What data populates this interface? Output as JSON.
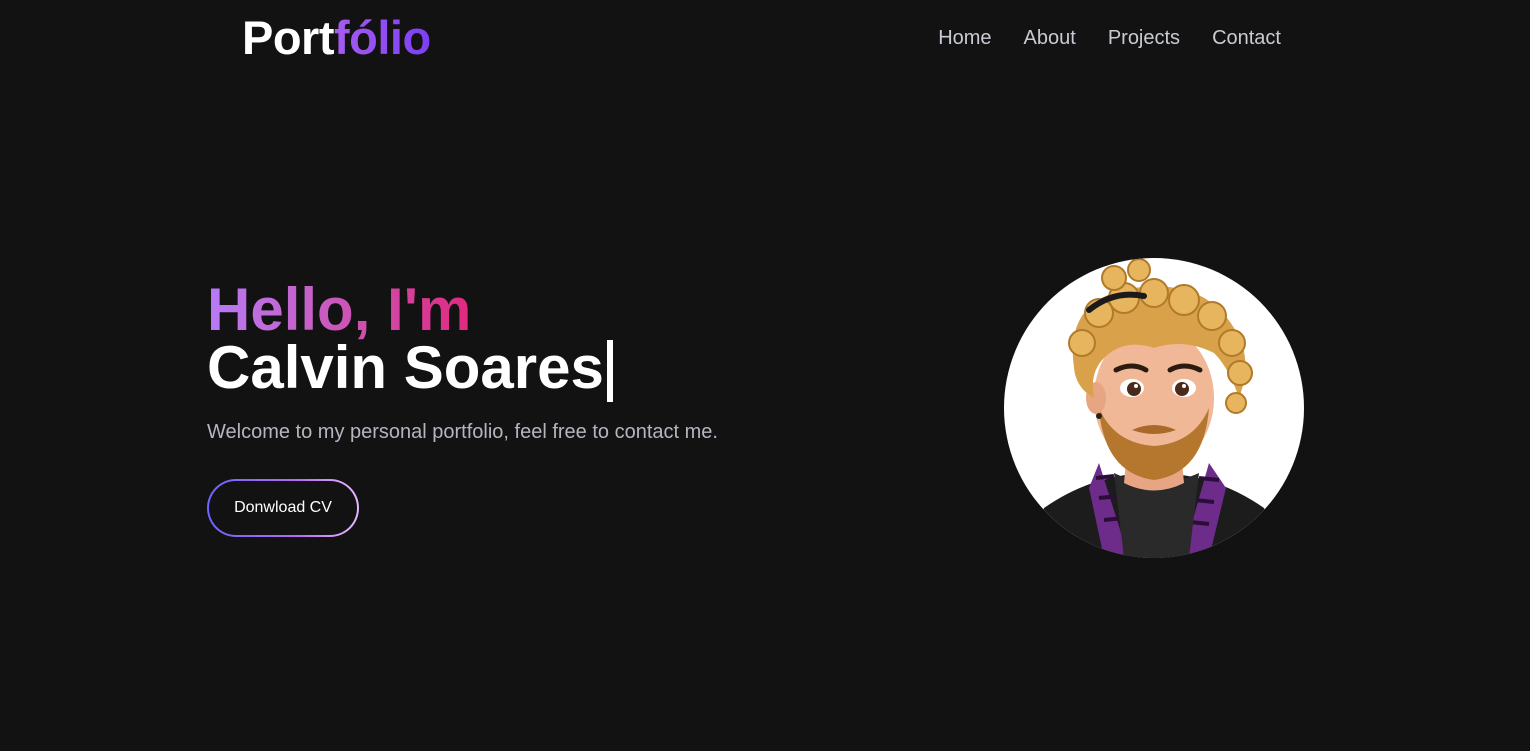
{
  "header": {
    "logo_main": "Port",
    "logo_accent": "fólio",
    "nav": [
      {
        "label": "Home"
      },
      {
        "label": "About"
      },
      {
        "label": "Projects"
      },
      {
        "label": "Contact"
      }
    ]
  },
  "hero": {
    "greeting": "Hello, I'm",
    "name": "Calvin Soares",
    "tagline": "Welcome to my personal portfolio, feel free to contact me.",
    "cv_button_label": "Donwload CV"
  },
  "avatar": {
    "description_icon": "profile-avatar-illustration"
  },
  "colors": {
    "background": "#121212",
    "logo_accent": "#8a4cf5",
    "greeting_gradient_start": "#b77cf7",
    "greeting_gradient_end": "#e0297e",
    "nav_text": "#c9cbd4",
    "tagline_text": "#b4b6bf"
  }
}
